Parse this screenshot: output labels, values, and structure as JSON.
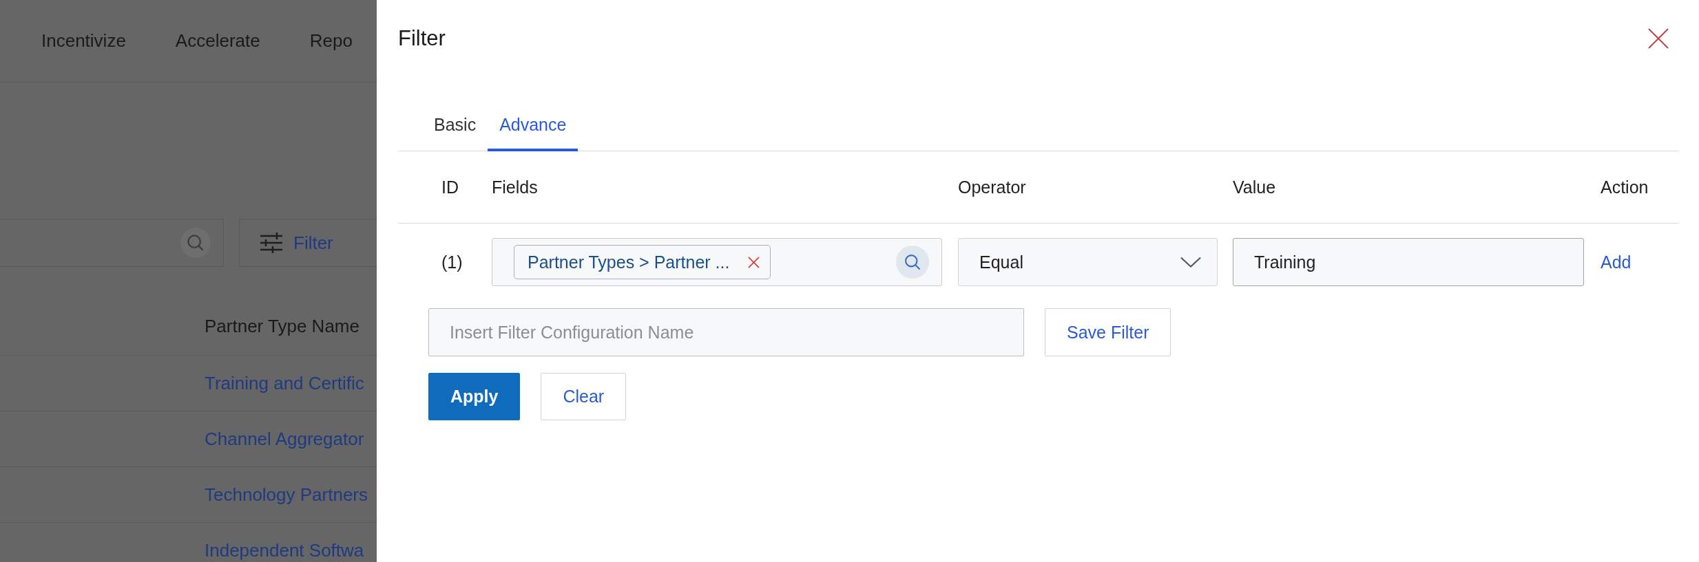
{
  "background_page": {
    "nav": [
      "Incentivize",
      "Accelerate",
      "Repo"
    ],
    "filter_button": "Filter",
    "table": {
      "column": "Partner Type Name",
      "rows": [
        "Training and Certific",
        "Channel Aggregator",
        "Technology Partners",
        "Independent Softwa"
      ]
    }
  },
  "filter_panel": {
    "title": "Filter",
    "tabs": [
      {
        "label": "Basic",
        "selected": false
      },
      {
        "label": "Advance",
        "selected": true
      }
    ],
    "columns": [
      "ID",
      "Fields",
      "Operator",
      "Value",
      "Action"
    ],
    "rows": [
      {
        "id": "(1)",
        "field_chip": "Partner Types > Partner ...",
        "operator": "Equal",
        "value": "Training",
        "action": "Add"
      }
    ],
    "config_name": {
      "placeholder": "Insert Filter Configuration Name"
    },
    "save_button": "Save Filter",
    "buttons": [
      {
        "label": "Apply",
        "kind": "primary"
      },
      {
        "label": "Clear",
        "kind": "secondary"
      }
    ]
  }
}
